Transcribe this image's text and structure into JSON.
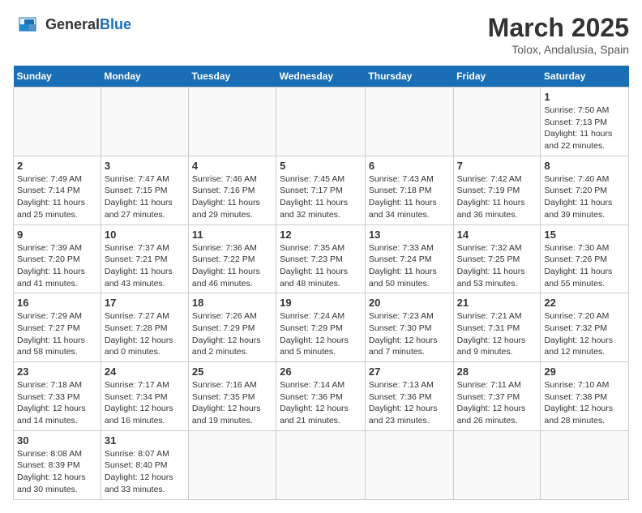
{
  "header": {
    "logo_general": "General",
    "logo_blue": "Blue",
    "month_title": "March 2025",
    "subtitle": "Tolox, Andalusia, Spain"
  },
  "weekdays": [
    "Sunday",
    "Monday",
    "Tuesday",
    "Wednesday",
    "Thursday",
    "Friday",
    "Saturday"
  ],
  "weeks": [
    [
      {
        "day": "",
        "info": ""
      },
      {
        "day": "",
        "info": ""
      },
      {
        "day": "",
        "info": ""
      },
      {
        "day": "",
        "info": ""
      },
      {
        "day": "",
        "info": ""
      },
      {
        "day": "",
        "info": ""
      },
      {
        "day": "1",
        "info": "Sunrise: 7:50 AM\nSunset: 7:13 PM\nDaylight: 11 hours\nand 22 minutes."
      }
    ],
    [
      {
        "day": "2",
        "info": "Sunrise: 7:49 AM\nSunset: 7:14 PM\nDaylight: 11 hours\nand 25 minutes."
      },
      {
        "day": "3",
        "info": "Sunrise: 7:47 AM\nSunset: 7:15 PM\nDaylight: 11 hours\nand 27 minutes."
      },
      {
        "day": "4",
        "info": "Sunrise: 7:46 AM\nSunset: 7:16 PM\nDaylight: 11 hours\nand 29 minutes."
      },
      {
        "day": "5",
        "info": "Sunrise: 7:45 AM\nSunset: 7:17 PM\nDaylight: 11 hours\nand 32 minutes."
      },
      {
        "day": "6",
        "info": "Sunrise: 7:43 AM\nSunset: 7:18 PM\nDaylight: 11 hours\nand 34 minutes."
      },
      {
        "day": "7",
        "info": "Sunrise: 7:42 AM\nSunset: 7:19 PM\nDaylight: 11 hours\nand 36 minutes."
      },
      {
        "day": "8",
        "info": "Sunrise: 7:40 AM\nSunset: 7:20 PM\nDaylight: 11 hours\nand 39 minutes."
      }
    ],
    [
      {
        "day": "9",
        "info": "Sunrise: 7:39 AM\nSunset: 7:20 PM\nDaylight: 11 hours\nand 41 minutes."
      },
      {
        "day": "10",
        "info": "Sunrise: 7:37 AM\nSunset: 7:21 PM\nDaylight: 11 hours\nand 43 minutes."
      },
      {
        "day": "11",
        "info": "Sunrise: 7:36 AM\nSunset: 7:22 PM\nDaylight: 11 hours\nand 46 minutes."
      },
      {
        "day": "12",
        "info": "Sunrise: 7:35 AM\nSunset: 7:23 PM\nDaylight: 11 hours\nand 48 minutes."
      },
      {
        "day": "13",
        "info": "Sunrise: 7:33 AM\nSunset: 7:24 PM\nDaylight: 11 hours\nand 50 minutes."
      },
      {
        "day": "14",
        "info": "Sunrise: 7:32 AM\nSunset: 7:25 PM\nDaylight: 11 hours\nand 53 minutes."
      },
      {
        "day": "15",
        "info": "Sunrise: 7:30 AM\nSunset: 7:26 PM\nDaylight: 11 hours\nand 55 minutes."
      }
    ],
    [
      {
        "day": "16",
        "info": "Sunrise: 7:29 AM\nSunset: 7:27 PM\nDaylight: 11 hours\nand 58 minutes."
      },
      {
        "day": "17",
        "info": "Sunrise: 7:27 AM\nSunset: 7:28 PM\nDaylight: 12 hours\nand 0 minutes."
      },
      {
        "day": "18",
        "info": "Sunrise: 7:26 AM\nSunset: 7:29 PM\nDaylight: 12 hours\nand 2 minutes."
      },
      {
        "day": "19",
        "info": "Sunrise: 7:24 AM\nSunset: 7:29 PM\nDaylight: 12 hours\nand 5 minutes."
      },
      {
        "day": "20",
        "info": "Sunrise: 7:23 AM\nSunset: 7:30 PM\nDaylight: 12 hours\nand 7 minutes."
      },
      {
        "day": "21",
        "info": "Sunrise: 7:21 AM\nSunset: 7:31 PM\nDaylight: 12 hours\nand 9 minutes."
      },
      {
        "day": "22",
        "info": "Sunrise: 7:20 AM\nSunset: 7:32 PM\nDaylight: 12 hours\nand 12 minutes."
      }
    ],
    [
      {
        "day": "23",
        "info": "Sunrise: 7:18 AM\nSunset: 7:33 PM\nDaylight: 12 hours\nand 14 minutes."
      },
      {
        "day": "24",
        "info": "Sunrise: 7:17 AM\nSunset: 7:34 PM\nDaylight: 12 hours\nand 16 minutes."
      },
      {
        "day": "25",
        "info": "Sunrise: 7:16 AM\nSunset: 7:35 PM\nDaylight: 12 hours\nand 19 minutes."
      },
      {
        "day": "26",
        "info": "Sunrise: 7:14 AM\nSunset: 7:36 PM\nDaylight: 12 hours\nand 21 minutes."
      },
      {
        "day": "27",
        "info": "Sunrise: 7:13 AM\nSunset: 7:36 PM\nDaylight: 12 hours\nand 23 minutes."
      },
      {
        "day": "28",
        "info": "Sunrise: 7:11 AM\nSunset: 7:37 PM\nDaylight: 12 hours\nand 26 minutes."
      },
      {
        "day": "29",
        "info": "Sunrise: 7:10 AM\nSunset: 7:38 PM\nDaylight: 12 hours\nand 28 minutes."
      }
    ],
    [
      {
        "day": "30",
        "info": "Sunrise: 8:08 AM\nSunset: 8:39 PM\nDaylight: 12 hours\nand 30 minutes."
      },
      {
        "day": "31",
        "info": "Sunrise: 8:07 AM\nSunset: 8:40 PM\nDaylight: 12 hours\nand 33 minutes."
      },
      {
        "day": "",
        "info": ""
      },
      {
        "day": "",
        "info": ""
      },
      {
        "day": "",
        "info": ""
      },
      {
        "day": "",
        "info": ""
      },
      {
        "day": "",
        "info": ""
      }
    ]
  ]
}
